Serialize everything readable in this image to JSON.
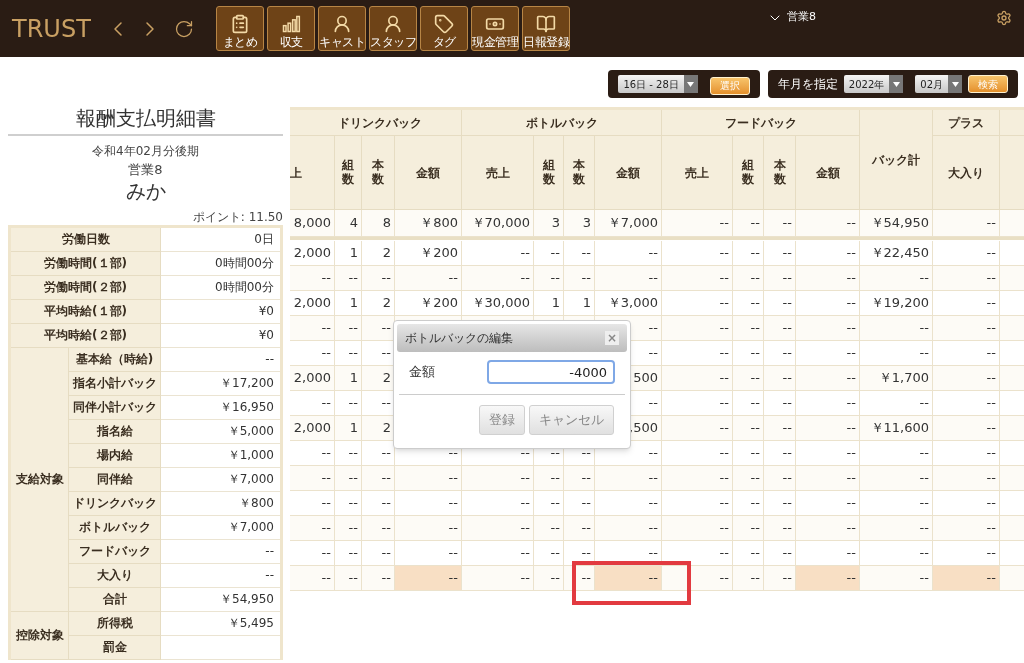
{
  "top_bar": {
    "logo": "TRUST",
    "toolbar": [
      {
        "label": "まとめ"
      },
      {
        "label": "収支"
      },
      {
        "label": "キャスト"
      },
      {
        "label": "スタッフ"
      },
      {
        "label": "タグ"
      },
      {
        "label": "現金管理"
      },
      {
        "label": "日報登録"
      }
    ],
    "user_menu": "営業8"
  },
  "filter_bar": {
    "range_select": "16日 - 28日",
    "select_button": "選択",
    "month_label": "年月を指定",
    "year_select": "2022年",
    "month_select": "02月",
    "search_button": "検索"
  },
  "statement": {
    "title": "報酬支払明細書",
    "period": "令和4年02月分後期",
    "staff": "営業8",
    "name": "みか",
    "points": "ポイント: 11.50",
    "rows": [
      {
        "kind": "row",
        "label": "労働日数",
        "value": "0日"
      },
      {
        "kind": "row",
        "label": "労働時間(１部)",
        "value": "0時間00分"
      },
      {
        "kind": "row",
        "label": "労働時間(２部)",
        "value": "0時間00分"
      },
      {
        "kind": "row",
        "label": "平均時給(１部)",
        "value": "¥0"
      },
      {
        "kind": "row",
        "label": "平均時給(２部)",
        "value": "¥0"
      },
      {
        "kind": "group",
        "label": "支給対象",
        "rows": [
          {
            "label": "基本給（時給)",
            "value": "--"
          },
          {
            "label": "指名小計バック",
            "value": "￥17,200"
          },
          {
            "label": "同伴小計バック",
            "value": "￥16,950"
          },
          {
            "label": "指名給",
            "value": "￥5,000"
          },
          {
            "label": "場内給",
            "value": "￥1,000"
          },
          {
            "label": "同伴給",
            "value": "￥7,000"
          },
          {
            "label": "ドリンクバック",
            "value": "￥800"
          },
          {
            "label": "ボトルバック",
            "value": "￥7,000"
          },
          {
            "label": "フードバック",
            "value": "--"
          },
          {
            "label": "大入り",
            "value": "--"
          },
          {
            "label": "合計",
            "value": "￥54,950"
          }
        ]
      },
      {
        "kind": "group",
        "label": "控除対象",
        "rows": [
          {
            "label": "所得税",
            "value": "￥5,495"
          },
          {
            "label": "罰金"
          }
        ]
      }
    ]
  },
  "table": {
    "groups": [
      {
        "kind": "group",
        "label": "ドリンクバック",
        "columns": [
          {
            "label": "上",
            "editable": false
          },
          {
            "label": "組数",
            "editable": false
          },
          {
            "label": "本数",
            "editable": false
          },
          {
            "label": "金額",
            "editable": true
          }
        ]
      },
      {
        "kind": "group",
        "label": "ボトルバック",
        "columns": [
          {
            "label": "売上",
            "editable": false
          },
          {
            "label": "組数",
            "editable": false
          },
          {
            "label": "本数",
            "editable": false
          },
          {
            "label": "金額",
            "editable": true
          }
        ]
      },
      {
        "kind": "group",
        "label": "フードバック",
        "columns": [
          {
            "label": "売上",
            "editable": false
          },
          {
            "label": "組数",
            "editable": false
          },
          {
            "label": "本数",
            "editable": false
          },
          {
            "label": "金額",
            "editable": true
          }
        ]
      },
      {
        "kind": "single",
        "label": "バック計",
        "columns": [
          {
            "editable": false
          }
        ]
      },
      {
        "kind": "group",
        "label": "プラス",
        "columns": [
          {
            "label": "大入り",
            "editable": true
          }
        ]
      }
    ],
    "rows": [
      {
        "kind": "total",
        "cells": [
          "8,000",
          "4",
          "8",
          "￥800",
          "￥70,000",
          "3",
          "3",
          "￥7,000",
          "--",
          "--",
          "--",
          "--",
          "￥54,950",
          "--"
        ]
      },
      {
        "kind": "detail",
        "cells": [
          "2,000",
          "1",
          "2",
          "￥200",
          "--",
          "--",
          "--",
          "--",
          "--",
          "--",
          "--",
          "--",
          "￥22,450",
          "--"
        ]
      },
      {
        "kind": "detail",
        "cells": [
          "--",
          "--",
          "--",
          "--",
          "--",
          "--",
          "--",
          "--",
          "--",
          "--",
          "--",
          "--",
          "--",
          "--"
        ]
      },
      {
        "kind": "detail",
        "cells": [
          "2,000",
          "1",
          "2",
          "￥200",
          "￥30,000",
          "1",
          "1",
          "￥3,000",
          "--",
          "--",
          "--",
          "--",
          "￥19,200",
          "--"
        ]
      },
      {
        "kind": "detail",
        "cells": [
          "--",
          "--",
          "--",
          null,
          null,
          null,
          null,
          "--",
          "--",
          "--",
          "--",
          "--",
          "--",
          "--"
        ]
      },
      {
        "kind": "detail",
        "cells": [
          "--",
          "--",
          "--",
          null,
          null,
          null,
          null,
          "--",
          "--",
          "--",
          "--",
          "--",
          "--",
          "--"
        ]
      },
      {
        "kind": "detail",
        "cells": [
          "2,000",
          "1",
          "2",
          null,
          null,
          null,
          null,
          "500",
          "--",
          "--",
          "--",
          "--",
          "￥1,700",
          "--"
        ]
      },
      {
        "kind": "detail",
        "cells": [
          "--",
          "--",
          "--",
          null,
          null,
          null,
          null,
          "--",
          "--",
          "--",
          "--",
          "--",
          "--",
          "--"
        ]
      },
      {
        "kind": "detail",
        "cells": [
          "2,000",
          "1",
          "2",
          null,
          null,
          null,
          null,
          ",500",
          "--",
          "--",
          "--",
          "--",
          "￥11,600",
          "--"
        ]
      },
      {
        "kind": "detail",
        "cells": [
          "--",
          "--",
          "--",
          "--",
          "--",
          "--",
          "--",
          "--",
          "--",
          "--",
          "--",
          "--",
          "--",
          "--"
        ]
      },
      {
        "kind": "detail",
        "cells": [
          "--",
          "--",
          "--",
          "--",
          "--",
          "--",
          "--",
          "--",
          "--",
          "--",
          "--",
          "--",
          "--",
          "--"
        ]
      },
      {
        "kind": "detail",
        "cells": [
          "--",
          "--",
          "--",
          "--",
          "--",
          "--",
          "--",
          "--",
          "--",
          "--",
          "--",
          "--",
          "--",
          "--"
        ]
      },
      {
        "kind": "detail",
        "cells": [
          "--",
          "--",
          "--",
          "--",
          "--",
          "--",
          "--",
          "--",
          "--",
          "--",
          "--",
          "--",
          "--",
          "--"
        ]
      },
      {
        "kind": "detail",
        "cells": [
          "--",
          "--",
          "--",
          "--",
          "--",
          "--",
          "--",
          "--",
          "--",
          "--",
          "--",
          "--",
          "--",
          "--"
        ]
      },
      {
        "kind": "input",
        "cells": [
          "--",
          "--",
          "--",
          "--",
          "--",
          "--",
          "--",
          "--",
          "--",
          "--",
          "--",
          "--",
          "--",
          "--"
        ]
      }
    ]
  },
  "dialog": {
    "title": "ボトルバックの編集",
    "close": "×",
    "field_label": "金額",
    "field_value": "-4000",
    "buttons": [
      "登録",
      "キャンセル"
    ]
  }
}
